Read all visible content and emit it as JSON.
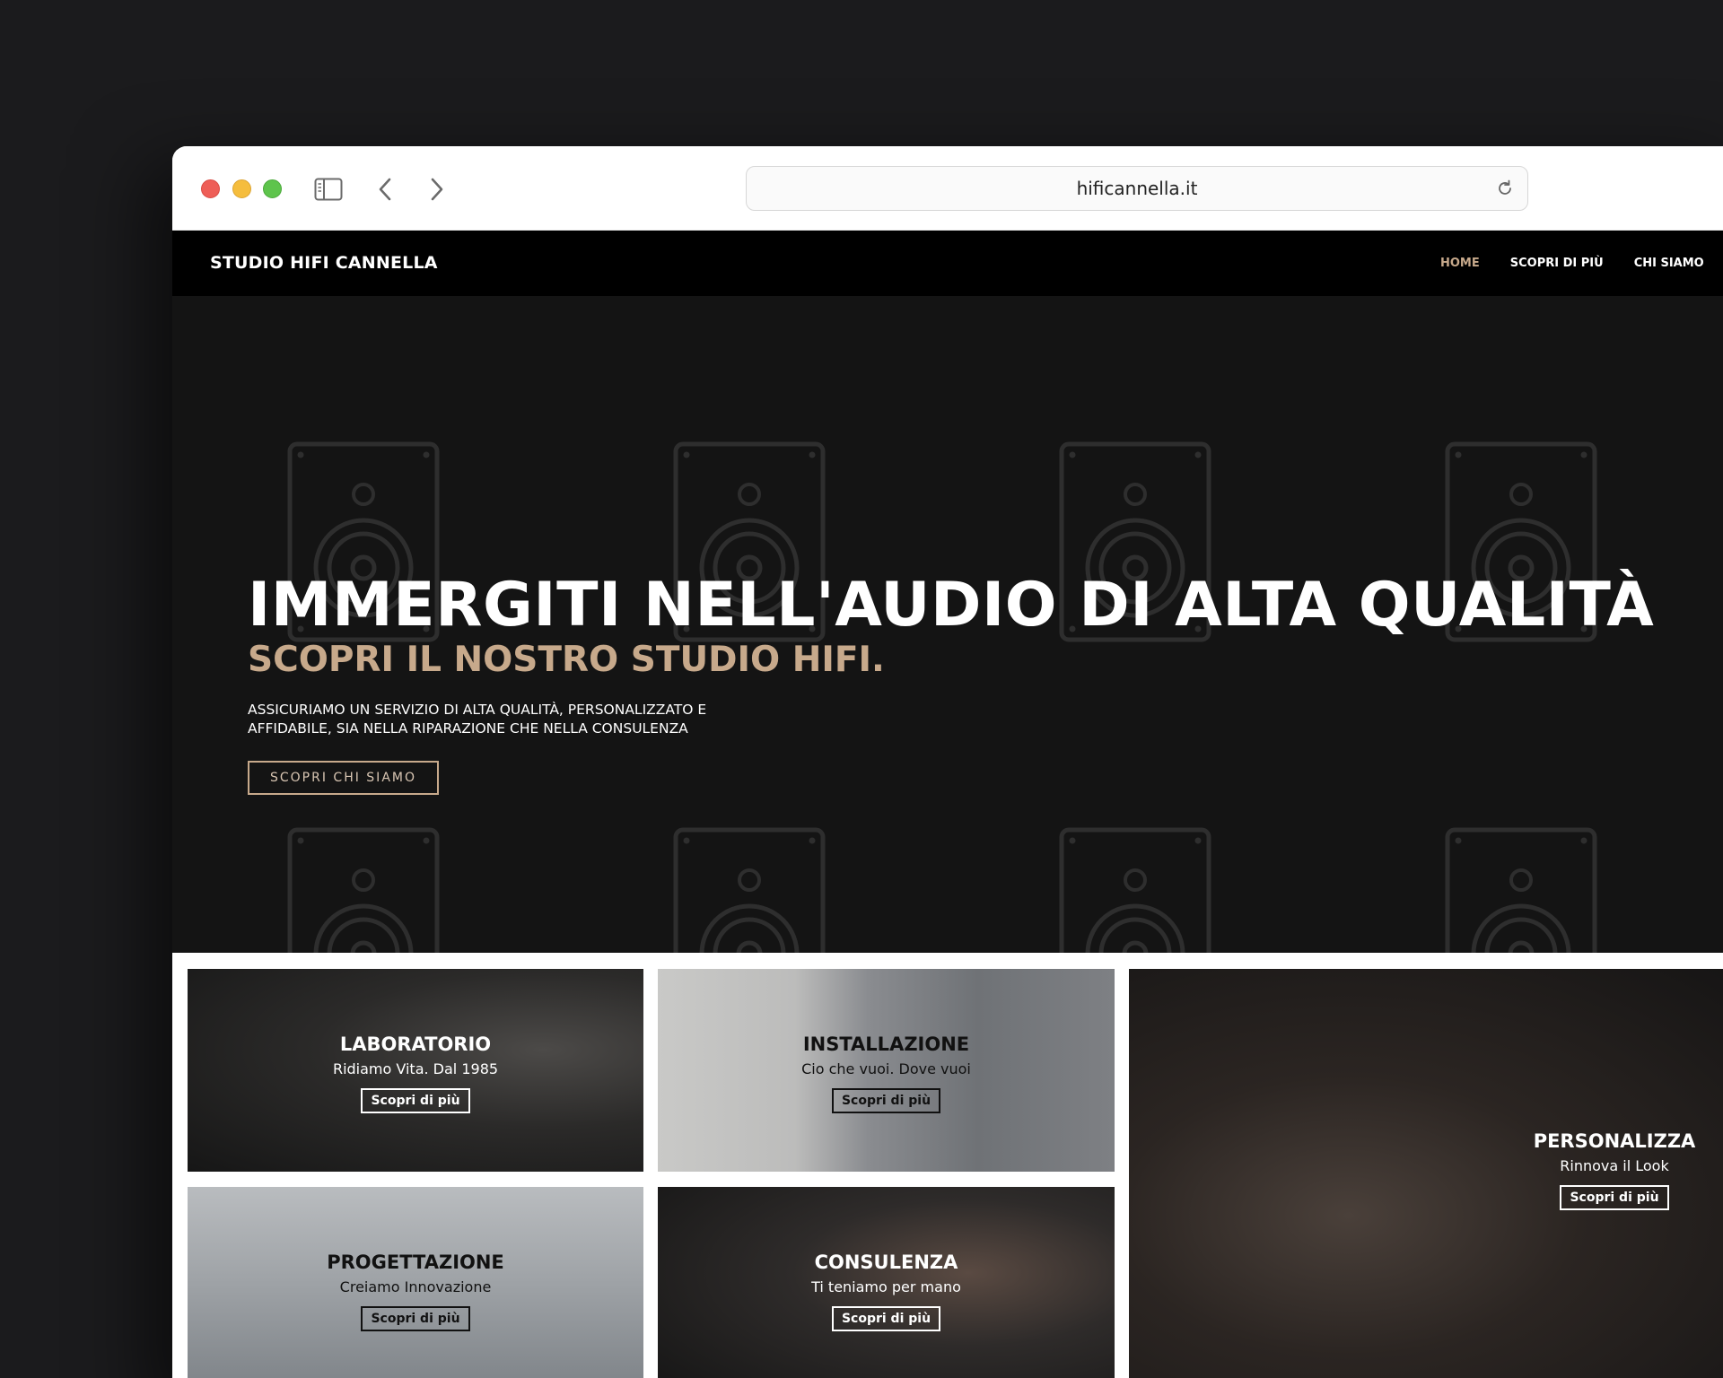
{
  "browser": {
    "url": "hificannella.it"
  },
  "nav": {
    "brand": "STUDIO HIFI CANNELLA",
    "links": [
      {
        "label": "HOME",
        "active": true
      },
      {
        "label": "SCOPRI DI PIÙ",
        "active": false
      },
      {
        "label": "CHI SIAMO",
        "active": false
      }
    ]
  },
  "hero": {
    "title": "IMMERGITI NELL'AUDIO DI ALTA QUALITÀ",
    "subtitle": "SCOPRI IL NOSTRO STUDIO HIFI.",
    "text_line1": "ASSICURIAMO UN SERVIZIO DI ALTA QUALITÀ, PERSONALIZZATO E",
    "text_line2": "AFFIDABILE, SIA NELLA RIPARAZIONE CHE NELLA CONSULENZA",
    "cta": "SCOPRI CHI SIAMO"
  },
  "cards": [
    {
      "title": "LABORATORIO",
      "subtitle": "Ridiamo Vita. Dal 1985",
      "button": "Scopri di più"
    },
    {
      "title": "INSTALLAZIONE",
      "subtitle": "Cio che vuoi. Dove vuoi",
      "button": "Scopri di più"
    },
    {
      "title": "PERSONALIZZA",
      "subtitle": "Rinnova il Look",
      "button": "Scopri di più"
    },
    {
      "title": "PROGETTAZIONE",
      "subtitle": "Creiamo Innovazione",
      "button": "Scopri di più"
    },
    {
      "title": "CONSULENZA",
      "subtitle": "Ti teniamo per mano",
      "button": "Scopri di più"
    }
  ],
  "colors": {
    "accent": "#c7a98b",
    "nav_bg": "#000000",
    "hero_bg": "#141414",
    "desktop_bg": "#1b1b1d"
  }
}
